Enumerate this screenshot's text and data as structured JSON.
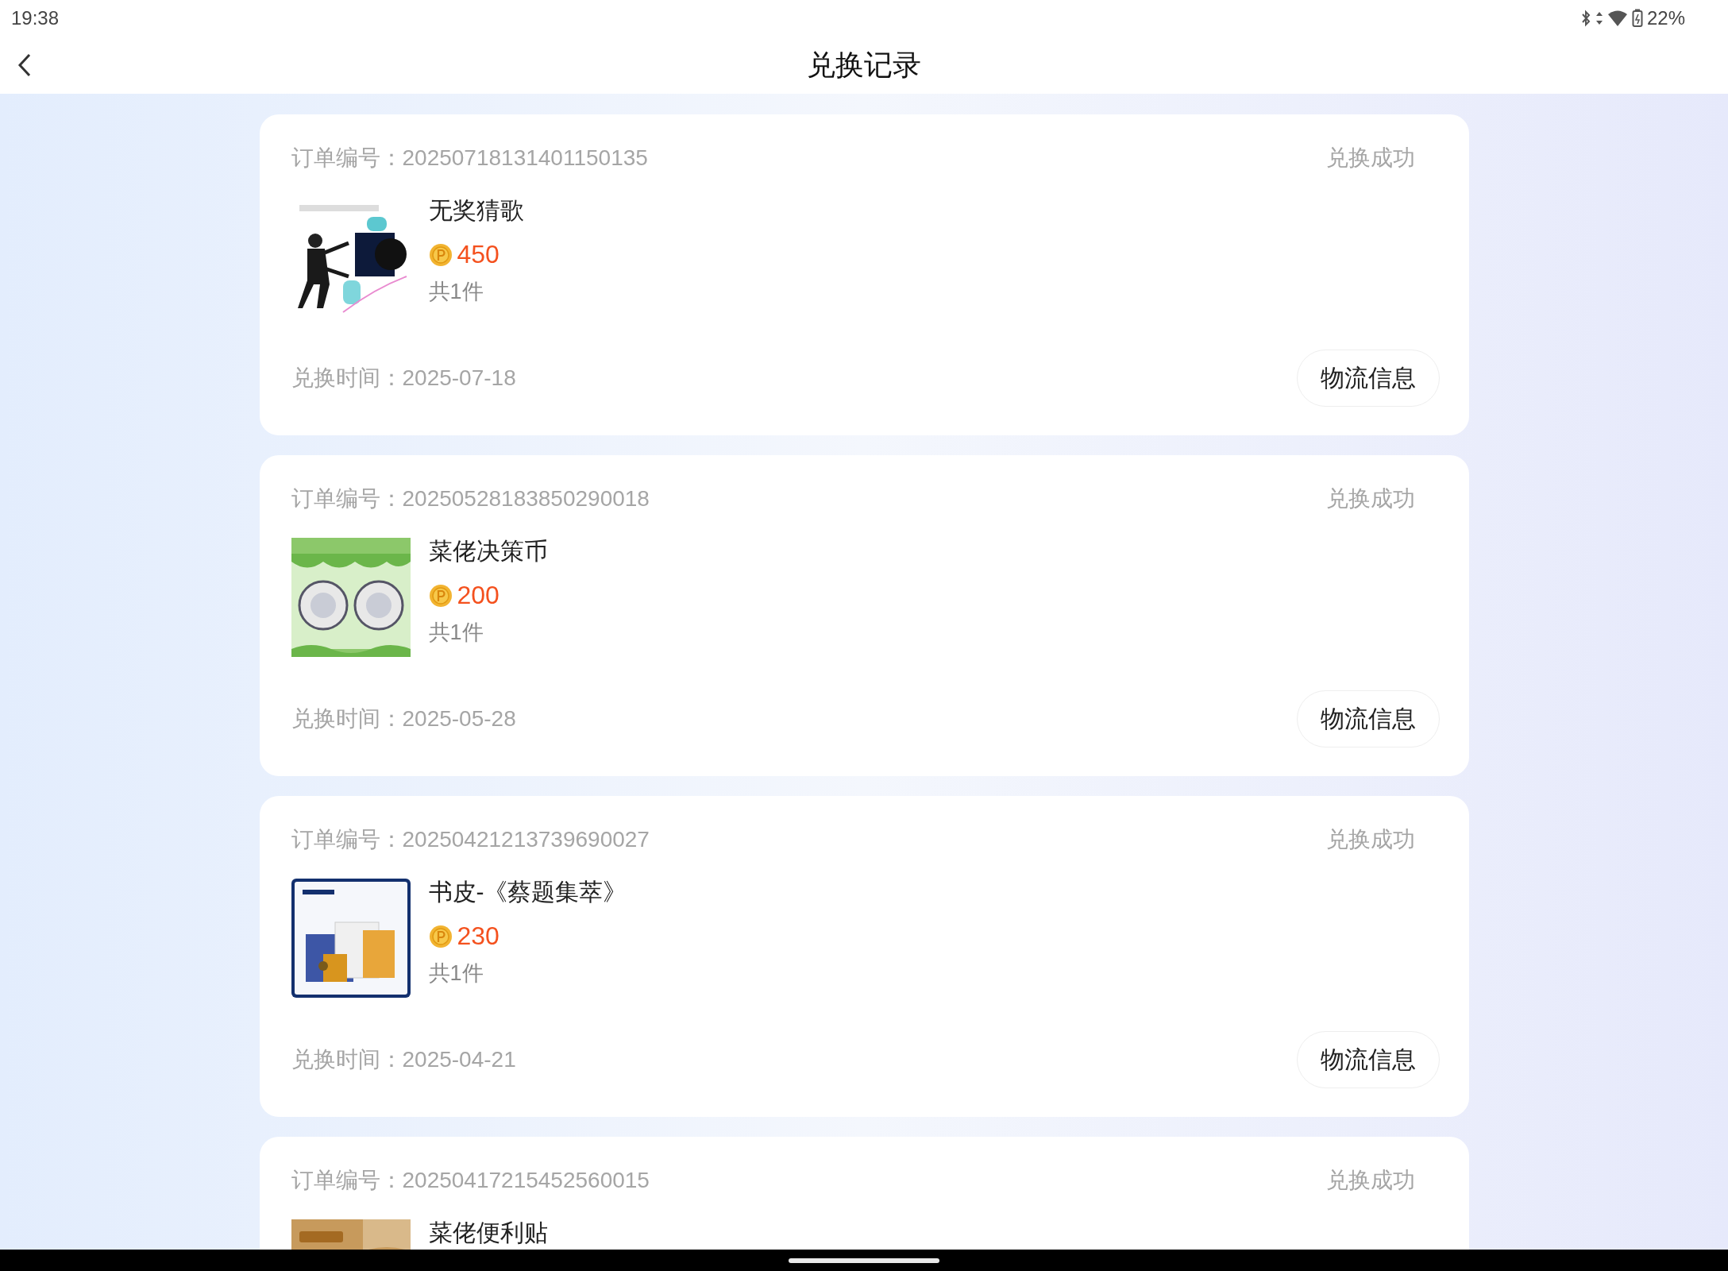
{
  "status_bar": {
    "time": "19:38",
    "battery": "22%"
  },
  "header": {
    "title": "兑换记录"
  },
  "orders": [
    {
      "order_label": "订单编号：",
      "order_no": "20250718131401150135",
      "status": "兑换成功",
      "title": "无奖猜歌",
      "price": "450",
      "count": "共1件",
      "time_label": "兑换时间：",
      "time": "2025-07-18",
      "button": "物流信息"
    },
    {
      "order_label": "订单编号：",
      "order_no": "20250528183850290018",
      "status": "兑换成功",
      "title": "菜佬决策币",
      "price": "200",
      "count": "共1件",
      "time_label": "兑换时间：",
      "time": "2025-05-28",
      "button": "物流信息"
    },
    {
      "order_label": "订单编号：",
      "order_no": "20250421213739690027",
      "status": "兑换成功",
      "title": "书皮-《蔡题集萃》",
      "price": "230",
      "count": "共1件",
      "time_label": "兑换时间：",
      "time": "2025-04-21",
      "button": "物流信息"
    },
    {
      "order_label": "订单编号：",
      "order_no": "20250417215452560015",
      "status": "兑换成功",
      "title": "菜佬便利贴"
    }
  ]
}
